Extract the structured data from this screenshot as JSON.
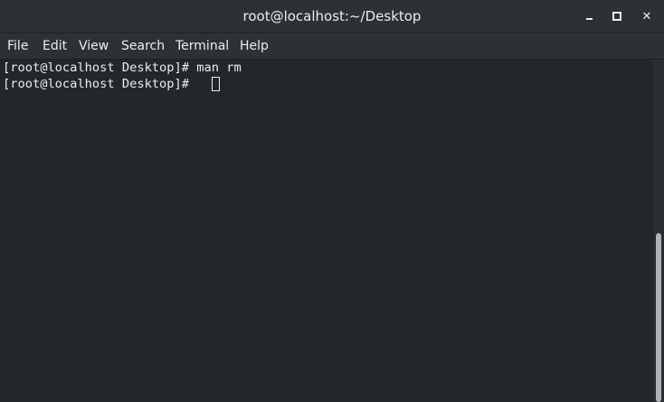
{
  "window": {
    "title": "root@localhost:~/Desktop",
    "controls": [
      "minimize-icon",
      "maximize-icon",
      "close-icon"
    ],
    "close_glyph": "✕"
  },
  "menu": {
    "items": [
      "File",
      "Edit",
      "View",
      "Search",
      "Terminal",
      "Help"
    ]
  },
  "terminal": {
    "lines": [
      "[root@localhost Desktop]# man rm",
      "[root@localhost Desktop]# "
    ]
  },
  "colors": {
    "background": "#232729",
    "foreground": "#eeeeec",
    "titlebar": "#2d3133"
  }
}
